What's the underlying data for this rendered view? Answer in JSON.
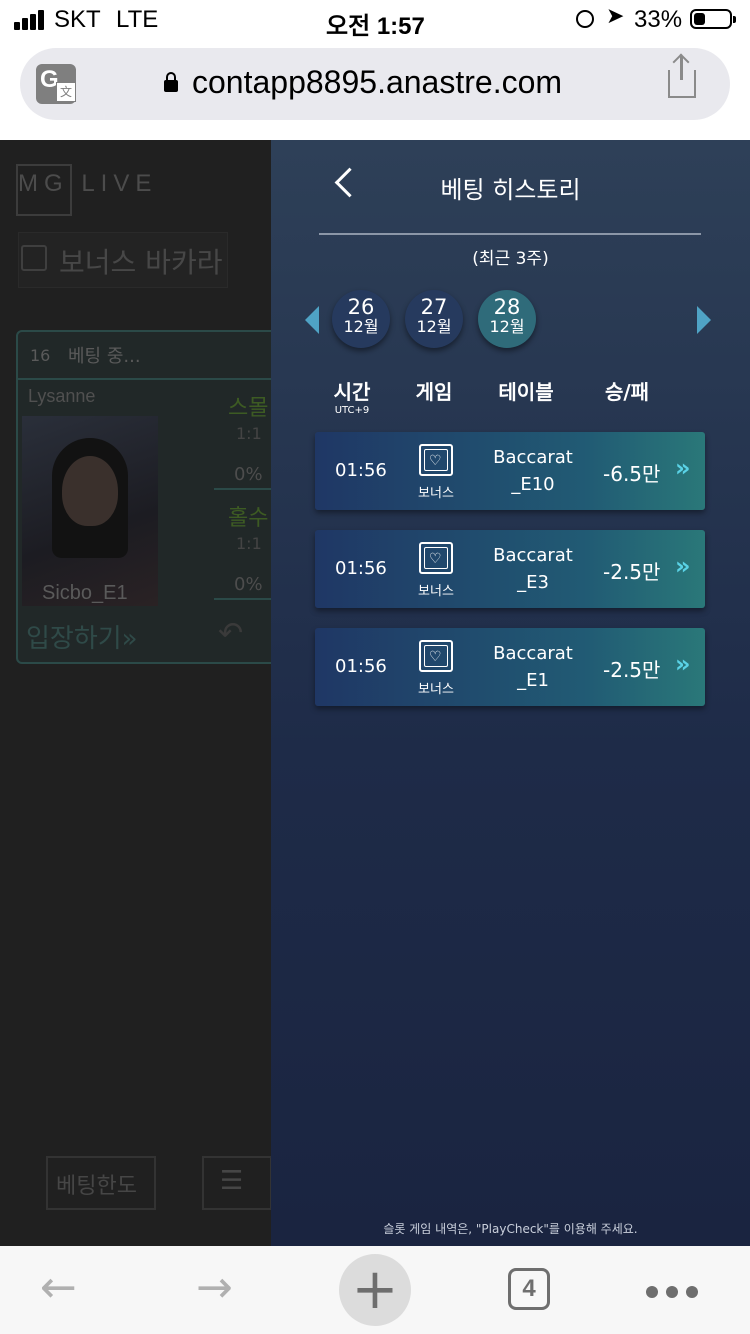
{
  "status_bar": {
    "carrier": "SKT",
    "network": "LTE",
    "time": "오전 1:57",
    "battery": "33%"
  },
  "browser": {
    "url": "contapp8895.anastre.com",
    "tab_count": "4"
  },
  "background_page": {
    "logo": "MG LIVE",
    "category": "보너스 바카라",
    "card": {
      "number": "16",
      "status": "베팅 중...",
      "dealer": "Lysanne",
      "table": "Sicbo_E1",
      "bet1_label": "스몰",
      "bet1_odds": "1:1",
      "bet1_pct": "0%",
      "bet2_label": "홀수",
      "bet2_odds": "1:1",
      "bet2_pct": "0%",
      "enter": "입장하기»"
    },
    "bet_limit_button": "베팅한도"
  },
  "panel": {
    "title": "베팅 히스토리",
    "subtitle": "(최근 3주)",
    "dates": [
      {
        "day": "26",
        "month": "12월"
      },
      {
        "day": "27",
        "month": "12월"
      },
      {
        "day": "28",
        "month": "12월"
      }
    ],
    "selected_date_index": 2,
    "headers": {
      "time": "시간",
      "time_sub": "UTC+9",
      "game": "게임",
      "table": "테이블",
      "result": "승/패"
    },
    "rows": [
      {
        "time": "01:56",
        "game": "보너스",
        "table_line1": "Baccarat",
        "table_line2": "_E10",
        "result": "-6.5만"
      },
      {
        "time": "01:56",
        "game": "보너스",
        "table_line1": "Baccarat",
        "table_line2": "_E3",
        "result": "-2.5만"
      },
      {
        "time": "01:56",
        "game": "보너스",
        "table_line1": "Baccarat",
        "table_line2": "_E1",
        "result": "-2.5만"
      }
    ],
    "footnote": "슬롯 게임 내역은, \"PlayCheck\"를 이용해 주세요."
  },
  "colors": {
    "panel_bg": "#2e4058",
    "row_accent": "#5ad2e6",
    "date_selected": "#2f6b7a"
  }
}
